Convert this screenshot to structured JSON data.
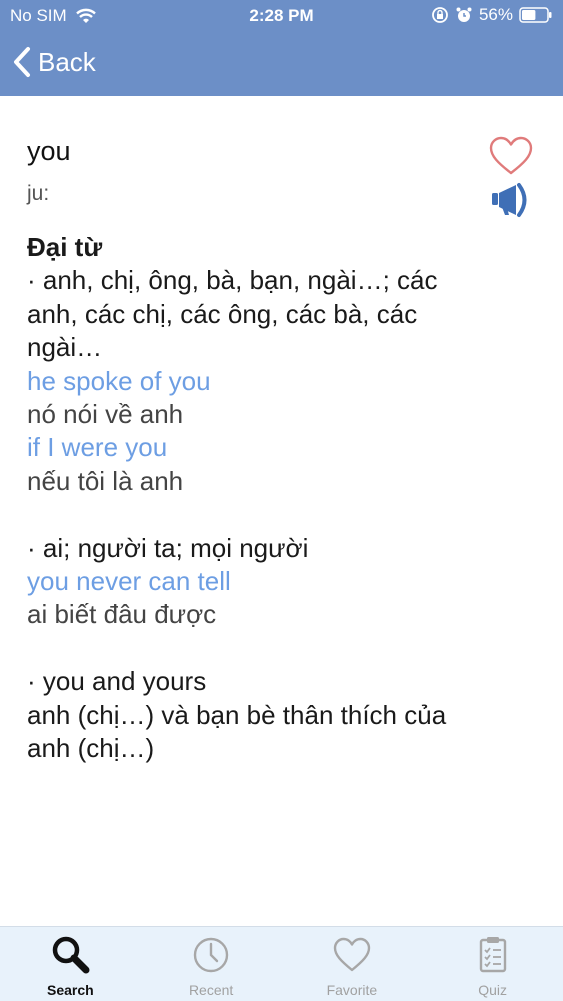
{
  "status_bar": {
    "carrier": "No SIM",
    "time": "2:28 PM",
    "battery_percent": "56%",
    "battery_level": 0.56,
    "icons": [
      "wifi-icon",
      "lock-rotation-icon",
      "alarm-icon",
      "battery-icon"
    ]
  },
  "nav": {
    "back_label": "Back"
  },
  "entry": {
    "word": "you",
    "phonetic": "ju:",
    "part_of_speech": "Đại từ",
    "lines": [
      "· anh, chị, ông, bà, bạn, ngài…; các",
      "anh, các chị, các ông, các bà, các",
      "ngài…"
    ],
    "examples_1": [
      {
        "en": "he spoke of you",
        "vi": "nó nói về anh"
      },
      {
        "en": "if I were you",
        "vi": "nếu tôi là anh"
      }
    ],
    "sense_2": "· ai; người ta; mọi người",
    "examples_2": [
      {
        "en": "you never can tell",
        "vi": "ai biết đâu được"
      }
    ],
    "sense_3": "· you and yours",
    "sense_3_translation": [
      "anh (chị…) và bạn bè thân thích của",
      "anh (chị…)"
    ]
  },
  "tabs": [
    {
      "label": "Search",
      "icon": "search-icon",
      "active": true
    },
    {
      "label": "Recent",
      "icon": "clock-icon",
      "active": false
    },
    {
      "label": "Favorite",
      "icon": "heart-icon",
      "active": false
    },
    {
      "label": "Quiz",
      "icon": "clipboard-icon",
      "active": false
    }
  ],
  "colors": {
    "header": "#6c8fc7",
    "example_text": "#6d9ee3",
    "heart": "#e07b7b",
    "speaker": "#3f6fb6",
    "tabbar": "#e8f2fb"
  }
}
